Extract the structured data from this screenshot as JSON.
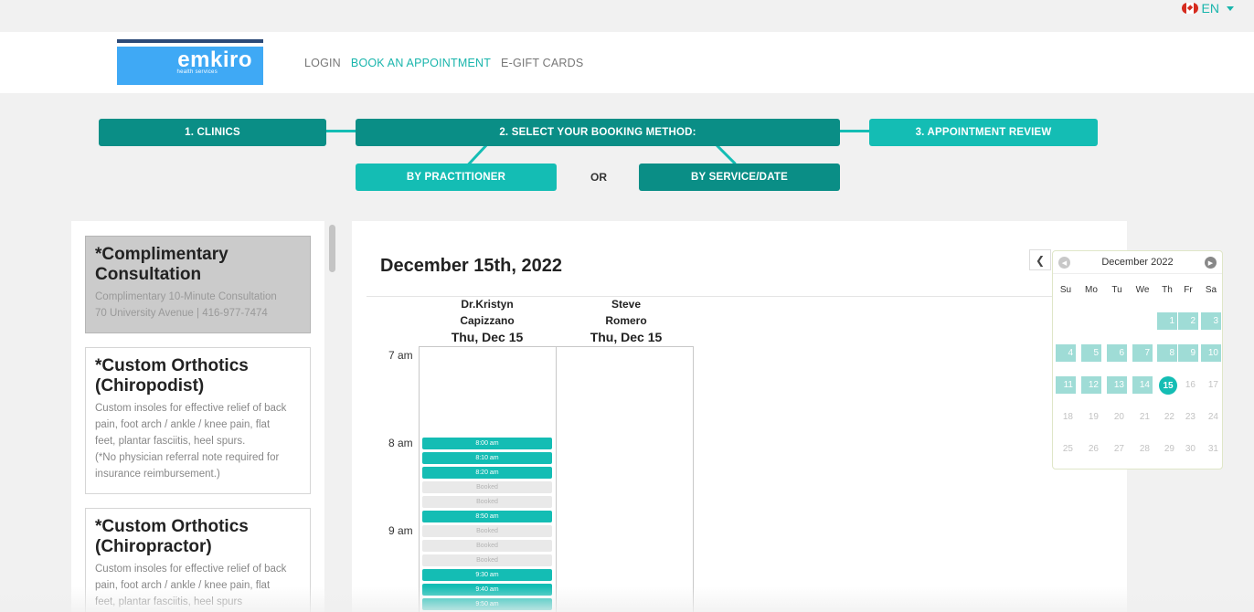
{
  "lang": {
    "label": "EN"
  },
  "logo": {
    "word": "emkiro",
    "sub": "health services"
  },
  "nav": {
    "login": "LOGIN",
    "book": "BOOK AN APPOINTMENT",
    "giftcards": "E-GIFT CARDS"
  },
  "steps": {
    "clinics": "1. CLINICS",
    "method": "2. SELECT YOUR BOOKING METHOD:",
    "review": "3. APPOINTMENT REVIEW",
    "by_practitioner": "BY PRACTITIONER",
    "or": "OR",
    "by_service": "BY SERVICE/DATE"
  },
  "services": [
    {
      "title": "*Complimentary Consultation",
      "lines": [
        "Complimentary 10-Minute Consultation",
        "70 University Avenue | 416-977-7474"
      ]
    },
    {
      "title": "*Custom Orthotics (Chiropodist)",
      "lines": [
        "Custom insoles for effective relief of back",
        "pain, foot arch / ankle / knee pain, flat",
        "feet, plantar fasciitis, heel spurs.",
        "(*No physician referral note required for",
        "insurance reimbursement.)"
      ]
    },
    {
      "title": "*Custom Orthotics (Chiropractor)",
      "lines": [
        "Custom insoles for effective relief of back",
        "pain, foot arch / ankle / knee pain, flat",
        "feet, plantar fasciitis, heel spurs"
      ]
    }
  ],
  "calendar": {
    "date_title": "December 15th, 2022",
    "practitioners": [
      {
        "name1": "Dr.Kristyn",
        "name2": "Capizzano",
        "day": "Thu, Dec 15"
      },
      {
        "name1": "Steve",
        "name2": "Romero",
        "day": "Thu, Dec 15"
      }
    ],
    "hours": [
      "7 am",
      "8 am",
      "9 am"
    ],
    "slots": [
      {
        "label": "8:00 am",
        "status": "open"
      },
      {
        "label": "8:10 am",
        "status": "open"
      },
      {
        "label": "8:20 am",
        "status": "open"
      },
      {
        "label": "Booked",
        "status": "booked"
      },
      {
        "label": "Booked",
        "status": "booked"
      },
      {
        "label": "8:50 am",
        "status": "open"
      },
      {
        "label": "Booked",
        "status": "booked"
      },
      {
        "label": "Booked",
        "status": "booked"
      },
      {
        "label": "Booked",
        "status": "booked"
      },
      {
        "label": "9:30 am",
        "status": "open"
      },
      {
        "label": "9:40 am",
        "status": "open"
      },
      {
        "label": "9:50 am",
        "status": "open"
      }
    ]
  },
  "mini_calendar": {
    "month": "December 2022",
    "dow": [
      "Su",
      "Mo",
      "Tu",
      "We",
      "Th",
      "Fr",
      "Sa"
    ],
    "first_weekday": 4,
    "days_in_month": 31,
    "available_days": [
      1,
      2,
      3,
      4,
      5,
      6,
      7,
      8,
      9,
      10,
      11,
      12,
      13,
      14
    ],
    "today": 15
  },
  "colors": {
    "accent": "#14bdb4",
    "dark_accent": "#0a8e86",
    "logo_blue": "#3fa9f5"
  }
}
